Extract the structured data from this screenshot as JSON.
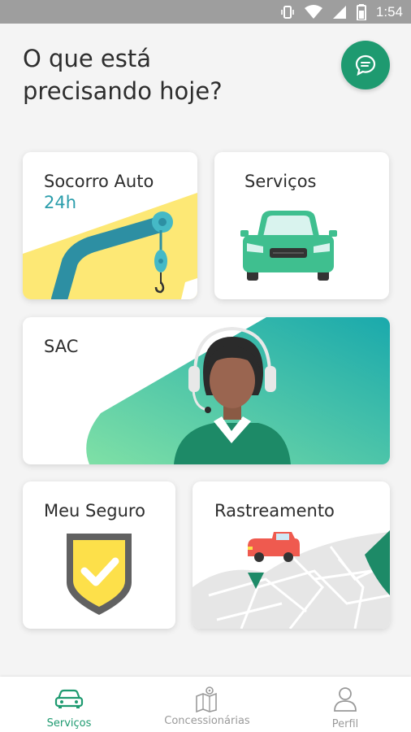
{
  "status_bar": {
    "time": "1:54",
    "icons": [
      "vibrate-icon",
      "wifi-icon",
      "signal-icon",
      "battery-icon"
    ]
  },
  "header": {
    "title_line1": "O que está",
    "title_line2": "precisando hoje?",
    "chat_icon": "chat-bubble-icon"
  },
  "cards": {
    "socorro": {
      "title": "Socorro Auto",
      "subtitle": "24h",
      "illustration": "tow-crane"
    },
    "servicos": {
      "title": "Serviços",
      "illustration": "green-car"
    },
    "sac": {
      "title": "SAC",
      "illustration": "attendant-headset"
    },
    "seguro": {
      "title": "Meu Seguro",
      "illustration": "shield-check"
    },
    "rastreamento": {
      "title": "Rastreamento",
      "illustration": "map-car"
    }
  },
  "bottom_nav": {
    "items": [
      {
        "label": "Serviços",
        "icon": "car-icon",
        "active": true
      },
      {
        "label": "Concessionárias",
        "icon": "map-pin-icon",
        "active": false
      },
      {
        "label": "Perfil",
        "icon": "user-icon",
        "active": false
      }
    ]
  },
  "colors": {
    "primary_green": "#1e9a70",
    "teal_text": "#2a9dab",
    "yellow": "#fde875"
  }
}
